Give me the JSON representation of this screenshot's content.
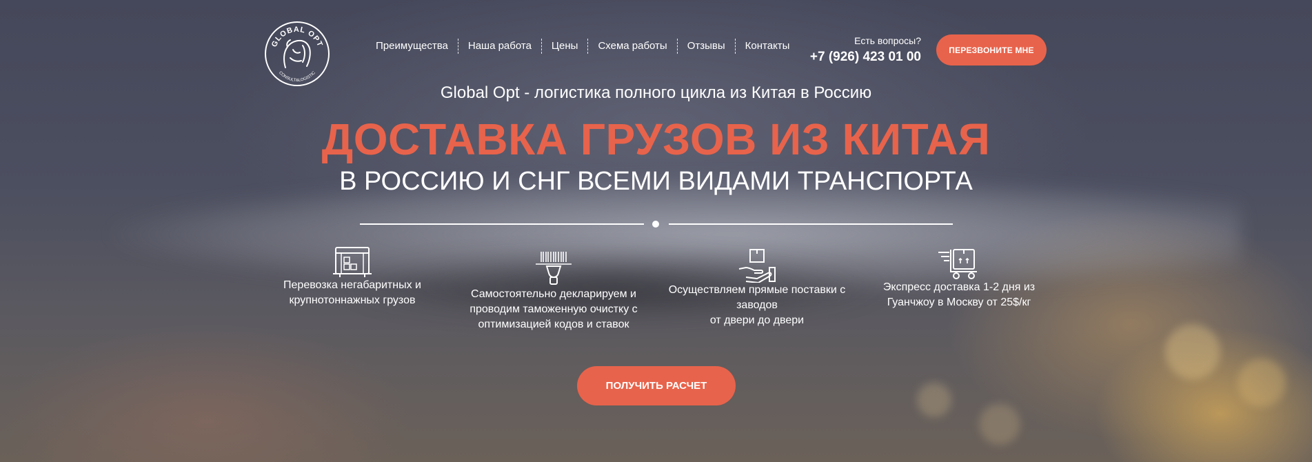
{
  "brand": {
    "logo_top_text": "GLOBAL OPT",
    "logo_bottom_text": "CONSULT&LOGISTIC"
  },
  "nav": {
    "items": [
      {
        "label": "Преимущества"
      },
      {
        "label": "Наша работа"
      },
      {
        "label": "Цены"
      },
      {
        "label": "Схема работы"
      },
      {
        "label": "Отзывы"
      },
      {
        "label": "Контакты"
      }
    ]
  },
  "contact": {
    "question": "Есть вопросы?",
    "phone": "+7 (926) 423 01 00",
    "callback_label": "ПЕРЕЗВОНИТЕ МНЕ"
  },
  "hero": {
    "subtitle": "Global Opt - логистика полного цикла из Китая в Россию",
    "headline": "ДОСТАВКА ГРУЗОВ ИЗ КИТАЯ",
    "subheadline": "В РОССИЮ И СНГ ВСЕМИ ВИДАМИ ТРАНСПОРТА"
  },
  "features": [
    {
      "icon": "container-icon",
      "text": "Перевозка негабаритных и\nкрупнотоннажных грузов"
    },
    {
      "icon": "barcode-scanner-icon",
      "text": "Самостоятельно декларируем и\nпроводим таможенную очистку с\nоптимизацией кодов и ставок"
    },
    {
      "icon": "box-in-hand-icon",
      "text": "Осуществляем прямые поставки с\nзаводов\nот двери до двери"
    },
    {
      "icon": "express-cart-icon",
      "text": "Экспресс доставка 1-2 дня из\nГуанчжоу в Москву от 25$/кг"
    }
  ],
  "cta": {
    "label": "ПОЛУЧИТЬ РАСЧЕТ"
  },
  "colors": {
    "accent": "#e8634b",
    "text": "#ffffff"
  }
}
